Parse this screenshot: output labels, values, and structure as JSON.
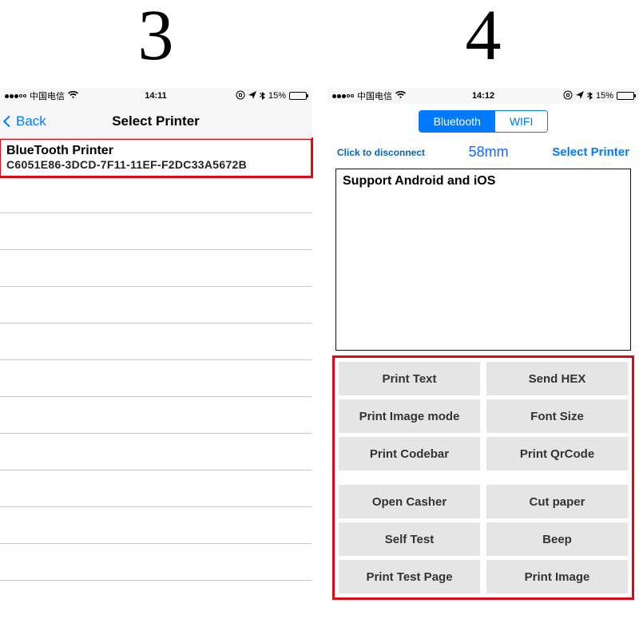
{
  "numerals": {
    "left": "3",
    "right": "4"
  },
  "status": {
    "carrier": "中国电信",
    "battery_pct": "15%",
    "time3": "14:11",
    "time4": "14:12"
  },
  "screen3": {
    "back_label": "Back",
    "title": "Select Printer",
    "printer": {
      "name": "BlueTooth Printer",
      "uuid": "C6051E86-3DCD-7F11-11EF-F2DC33A5672B"
    }
  },
  "screen4": {
    "seg": {
      "bluetooth": "Bluetooth",
      "wifi": "WIFI"
    },
    "disconnect": "Click to disconnect",
    "paper_size": "58mm",
    "select_printer": "Select Printer",
    "textarea_value": "Support Android and iOS",
    "buttons": {
      "b1": "Print Text",
      "b2": "Send HEX",
      "b3": "Print Image mode",
      "b4": "Font Size",
      "b5": "Print Codebar",
      "b6": "Print QrCode",
      "b7": "Open Casher",
      "b8": "Cut paper",
      "b9": "Self Test",
      "b10": "Beep",
      "b11": "Print Test Page",
      "b12": "Print Image"
    }
  }
}
